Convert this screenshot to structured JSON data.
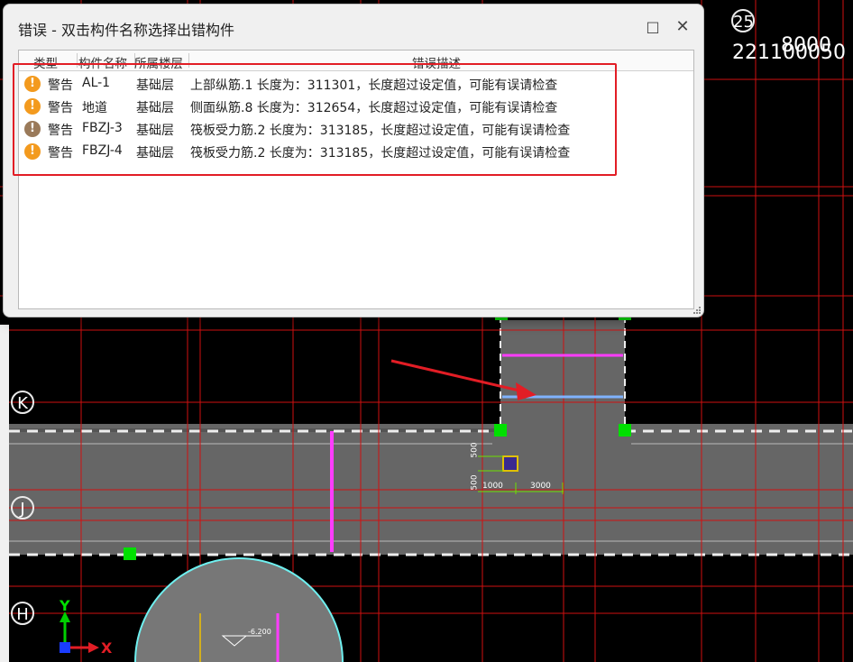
{
  "dialog": {
    "title": "错误 - 双击构件名称选择出错构件",
    "maximize_icon": "□",
    "close_icon": "✕",
    "columns": [
      "类型",
      "构件名称",
      "所属楼层",
      "错误描述"
    ],
    "rows": [
      {
        "type": "警告",
        "name": "AL-1",
        "floor": "基础层",
        "desc": "上部纵筋.1 长度为：311301，长度超过设定值，可能有误请检查",
        "icon_color": "#f39a1e"
      },
      {
        "type": "警告",
        "name": "地道",
        "floor": "基础层",
        "desc": "侧面纵筋.8 长度为：312654，长度超过设定值，可能有误请检查",
        "icon_color": "#f39a1e"
      },
      {
        "type": "警告",
        "name": "FBZJ-3",
        "floor": "基础层",
        "desc": "筏板受力筋.2 长度为：313185，长度超过设定值，可能有误请检查",
        "icon_color": "#9a7a5a"
      },
      {
        "type": "警告",
        "name": "FBZJ-4",
        "floor": "基础层",
        "desc": "筏板受力筋.2 长度为：313185，长度超过设定值，可能有误请检查",
        "icon_color": "#f39a1e"
      }
    ]
  },
  "cad": {
    "axis_labels": [
      "25",
      "K",
      "J",
      "H"
    ],
    "top_dims": [
      "8000",
      "221100050"
    ],
    "small_dims": [
      "500",
      "500",
      "1000",
      "3000"
    ],
    "elevation": "-6.200",
    "ucs": {
      "x": "X",
      "y": "Y"
    }
  },
  "colors": {
    "highlight": "#e21d25",
    "grid": "#d01010",
    "magenta": "#ff3cff",
    "green": "#00e000",
    "light_blue": "#7fb2ff"
  }
}
